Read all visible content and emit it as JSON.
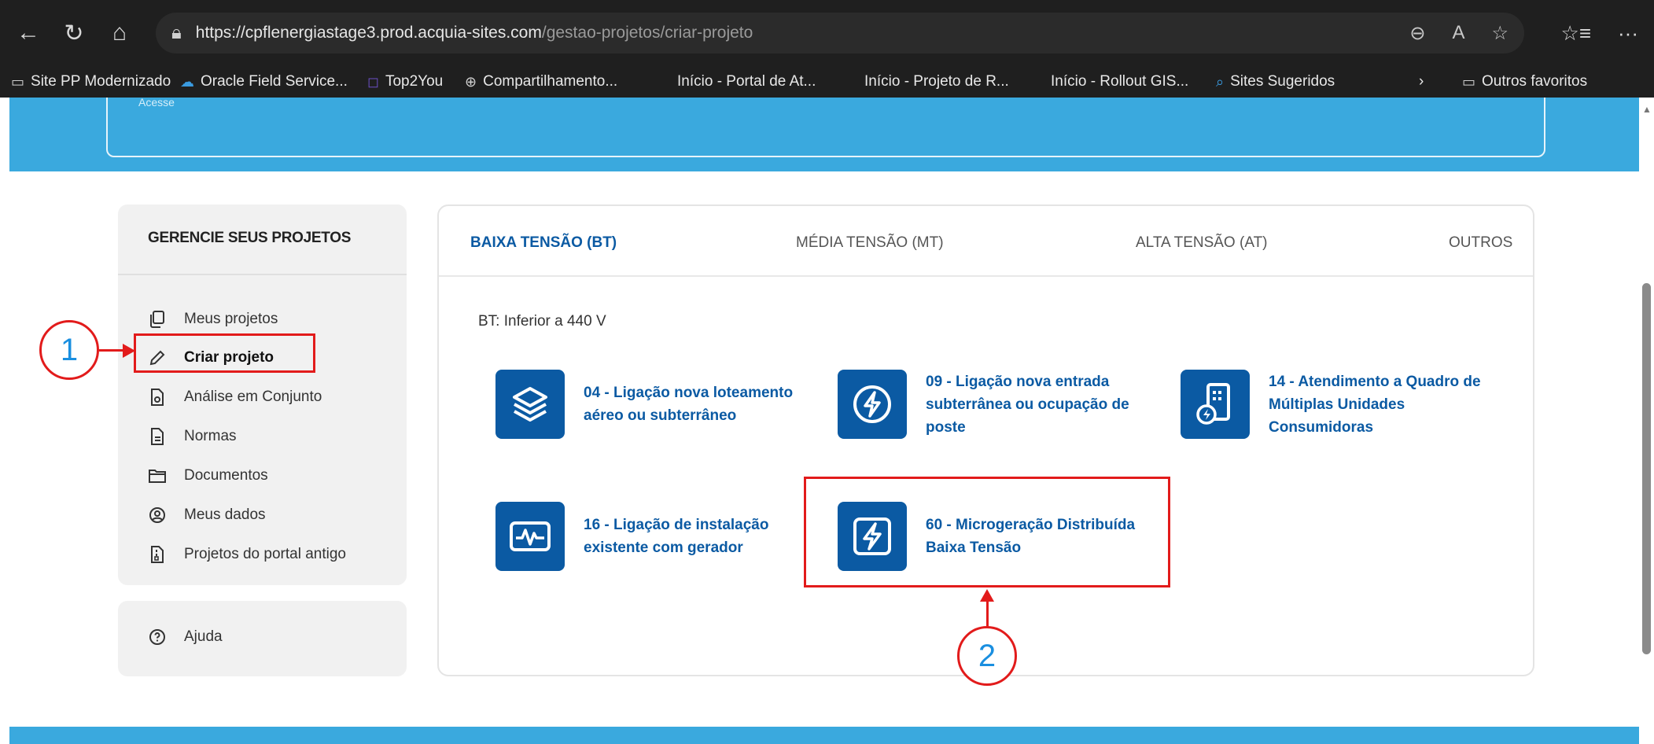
{
  "browser": {
    "url_domain": "https://cpflenergiastage3.prod.acquia-sites.com",
    "url_path": "/gestao-projetos/criar-projeto",
    "bookmarks": [
      "Site PP Modernizado",
      "Oracle Field Service...",
      "Top2You",
      "Compartilhamento...",
      "Início - Portal de At...",
      "Início - Projeto de R...",
      "Início - Rollout GIS...",
      "Sites Sugeridos"
    ],
    "other_favorites": "Outros favoritos"
  },
  "hero": {
    "partial_text": "Acesse"
  },
  "sidebar": {
    "title": "GERENCIE SEUS PROJETOS",
    "items": [
      {
        "label": "Meus projetos",
        "icon": "copy-icon"
      },
      {
        "label": "Criar projeto",
        "icon": "pencil-icon"
      },
      {
        "label": "Análise em Conjunto",
        "icon": "file-share-icon"
      },
      {
        "label": "Normas",
        "icon": "document-icon"
      },
      {
        "label": "Documentos",
        "icon": "folder-icon"
      },
      {
        "label": "Meus dados",
        "icon": "user-circle-icon"
      },
      {
        "label": "Projetos do portal antigo",
        "icon": "file-archive-icon"
      }
    ],
    "help_label": "Ajuda"
  },
  "tabs": [
    "BAIXA TENSÃO (BT)",
    "MÉDIA TENSÃO (MT)",
    "ALTA TENSÃO (AT)",
    "OUTROS"
  ],
  "bt_label": "BT: Inferior a 440 V",
  "options": [
    {
      "label": "04 - Ligação nova loteamento aéreo ou subterrâneo",
      "icon": "layers-icon"
    },
    {
      "label": "09 - Ligação nova entrada subterrânea ou ocupação de poste",
      "icon": "lightning-circle-icon"
    },
    {
      "label": "14 - Atendimento a Quadro de Múltiplas Unidades Consumidoras",
      "icon": "building-lightning-icon"
    },
    {
      "label": "16 - Ligação de instalação existente com gerador",
      "icon": "waveform-icon"
    },
    {
      "label": "60 - Microgeração Distribuída Baixa Tensão",
      "icon": "lightning-square-icon"
    }
  ],
  "annotations": {
    "step1": "1",
    "step2": "2"
  },
  "colors": {
    "brand_blue": "#0b5aa3",
    "hero_blue": "#3aa9de",
    "annotation_red": "#e21b1b",
    "annotation_number": "#1a8fe0"
  }
}
